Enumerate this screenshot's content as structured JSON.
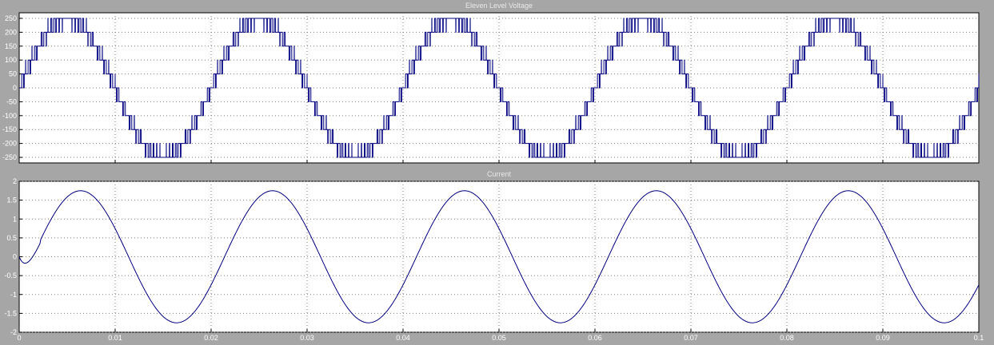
{
  "chart_data": [
    {
      "type": "line",
      "title": "Eleven Level Voltage",
      "xlim": [
        0,
        0.1
      ],
      "ylim": [
        -270,
        270
      ],
      "xticks": [
        "0",
        "0.01",
        "0.02",
        "0.03",
        "0.04",
        "0.05",
        "0.06",
        "0.07",
        "0.08",
        "0.09",
        "0.1"
      ],
      "x_tick_labels_visible": false,
      "yticks": [
        250,
        200,
        150,
        100,
        50,
        0,
        -50,
        -100,
        -150,
        -200,
        -250
      ],
      "grid": true,
      "series": [
        {
          "levels": [
            -250,
            -200,
            -150,
            -100,
            -50,
            0,
            50,
            100,
            150,
            200,
            250
          ],
          "fundamental_hz": 50,
          "amplitude": 250,
          "color": "#00007f"
        }
      ]
    },
    {
      "type": "line",
      "title": "Current",
      "xlim": [
        0,
        0.1
      ],
      "ylim": [
        -2,
        2
      ],
      "xticks": [
        "0",
        "0.01",
        "0.02",
        "0.03",
        "0.04",
        "0.05",
        "0.06",
        "0.07",
        "0.08",
        "0.09",
        "0.1"
      ],
      "yticks": [
        "2",
        "1.5",
        "1",
        "0.5",
        "0",
        "-0.5",
        "-1",
        "-1.5",
        "-2"
      ],
      "grid": true,
      "series": [
        {
          "amplitude": 1.75,
          "fundamental_hz": 50,
          "phase_lag_s": 0.0014,
          "color": "#00007f"
        }
      ]
    }
  ]
}
